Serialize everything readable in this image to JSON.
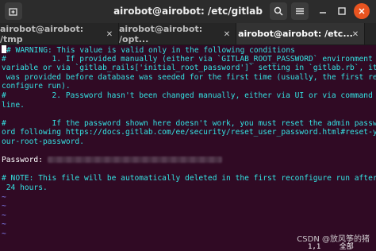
{
  "window": {
    "title": "airobot@airobot: /etc/gitlab"
  },
  "tabs": [
    {
      "label": "airobot@airobot: /tmp"
    },
    {
      "label": "airobot@airobot: /opt..."
    },
    {
      "label": "airobot@airobot: /etc..."
    }
  ],
  "icons": {
    "new_tab": "new-tab-icon",
    "search": "search-icon",
    "menu": "hamburger-menu-icon",
    "minimize": "minimize-icon",
    "maximize": "maximize-icon",
    "close": "close-icon"
  },
  "terminal": {
    "lines": [
      "# WARNING: This value is valid only in the following conditions",
      "#          1. If provided manually (either via `GITLAB_ROOT_PASSWORD` environment",
      "variable or via `gitlab_rails['initial_root_password']` setting in `gitlab.rb`, it",
      " was provided before database was seeded for the first time (usually, the first re",
      "configure run).",
      "#          2. Password hasn't been changed manually, either via UI or via command",
      "line.",
      "",
      "#          If the password shown here doesn't work, you must reset the admin passw",
      "ord following https://docs.gitlab.com/ee/security/reset_user_password.html#reset-y",
      "our-root-password.",
      "",
      "Password: ",
      "",
      "# NOTE: This file will be automatically deleted in the first reconfigure run after",
      " 24 hours.",
      "~",
      "~",
      "~",
      "~",
      "~"
    ],
    "status_position": "1,1",
    "status_scroll": "全部"
  },
  "watermark": "CSDN @放风筝的猪"
}
